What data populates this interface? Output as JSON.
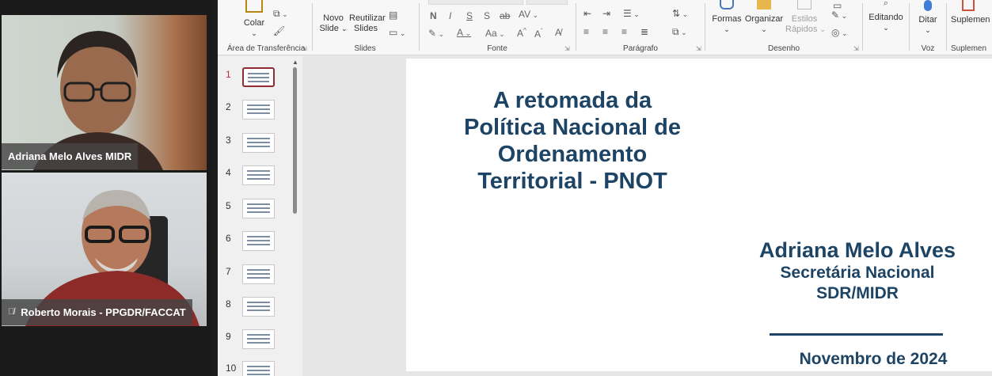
{
  "video": {
    "participants": [
      {
        "name": "Adriana Melo Alves MIDR"
      },
      {
        "name": "Roberto Morais - PPGDR/FACCAT",
        "muted": true
      }
    ]
  },
  "ribbon": {
    "clipboard": {
      "paste_label": "Colar",
      "group_label": "Área de Transferência"
    },
    "slides": {
      "new_slide_line1": "Novo",
      "new_slide_line2": "Slide",
      "reuse_line1": "Reutilizar",
      "reuse_line2": "Slides",
      "group_label": "Slides"
    },
    "font": {
      "bold": "N",
      "italic": "I",
      "underline": "S",
      "shadow": "S",
      "strike": "ab",
      "spacing": "AV",
      "case": "Aa",
      "grow": "A",
      "shrink": "A",
      "group_label": "Fonte"
    },
    "paragraph": {
      "group_label": "Parágrafo"
    },
    "drawing": {
      "shapes_label": "Formas",
      "arrange_label": "Organizar",
      "quick_styles_line1": "Estilos",
      "quick_styles_line2": "Rápidos",
      "group_label": "Desenho"
    },
    "editing": {
      "label": "Editando"
    },
    "voice": {
      "dictate_label": "Ditar",
      "group_label": "Voz"
    },
    "supplements": {
      "label": "Suplemen",
      "group_label": "Suplemen"
    }
  },
  "thumbnails": [
    {
      "num": "1",
      "active": true
    },
    {
      "num": "2"
    },
    {
      "num": "3"
    },
    {
      "num": "4"
    },
    {
      "num": "5"
    },
    {
      "num": "6"
    },
    {
      "num": "7"
    },
    {
      "num": "8"
    },
    {
      "num": "9"
    },
    {
      "num": "10"
    }
  ],
  "slide": {
    "title_lines": [
      "A retomada da",
      "Política Nacional de",
      "Ordenamento",
      "Territorial - PNOT"
    ],
    "author_name": "Adriana Melo Alves",
    "author_role": "Secretária Nacional",
    "author_org": "SDR/MIDR",
    "date": "Novembro de 2024"
  },
  "colors": {
    "slide_text": "#1d4465",
    "active_thumb": "#8e2b33"
  }
}
